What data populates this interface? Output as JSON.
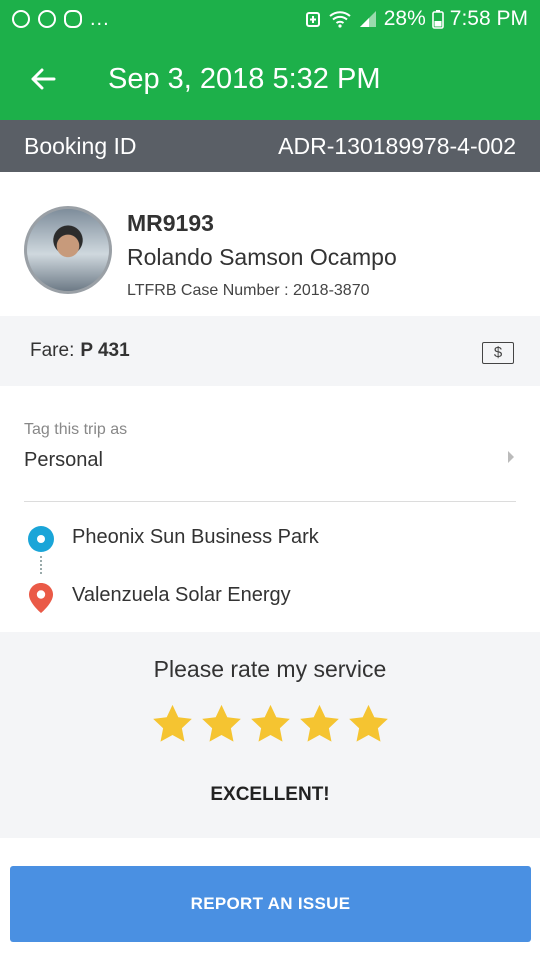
{
  "status_bar": {
    "left_icons": [
      "messenger-icon",
      "whatsapp-icon",
      "grab-icon"
    ],
    "more": "...",
    "battery": "28%",
    "time": "7:58 PM"
  },
  "app_bar": {
    "title": "Sep 3, 2018 5:32 PM"
  },
  "booking": {
    "label": "Booking ID",
    "id": "ADR-130189978-4-002"
  },
  "driver": {
    "plate": "MR9193",
    "name": "Rolando Samson Ocampo",
    "case_number": "LTFRB Case Number : 2018-3870"
  },
  "fare": {
    "label": "Fare:",
    "amount": "P 431",
    "icon": "$"
  },
  "tag": {
    "label": "Tag this trip as",
    "value": "Personal"
  },
  "route": {
    "pickup": "Pheonix Sun Business Park",
    "dropoff": "Valenzuela Solar Energy"
  },
  "rating": {
    "prompt": "Please rate my service",
    "stars": 5,
    "max_stars": 5,
    "word": "EXCELLENT!",
    "star_color": "#f5c431"
  },
  "actions": {
    "report_label": "REPORT AN ISSUE"
  },
  "colors": {
    "brand_green": "#1db04a",
    "booking_bar": "#5a5f66",
    "report_blue": "#4a90e2",
    "pickup_blue": "#1aa5d8",
    "drop_red": "#ea5a47"
  }
}
